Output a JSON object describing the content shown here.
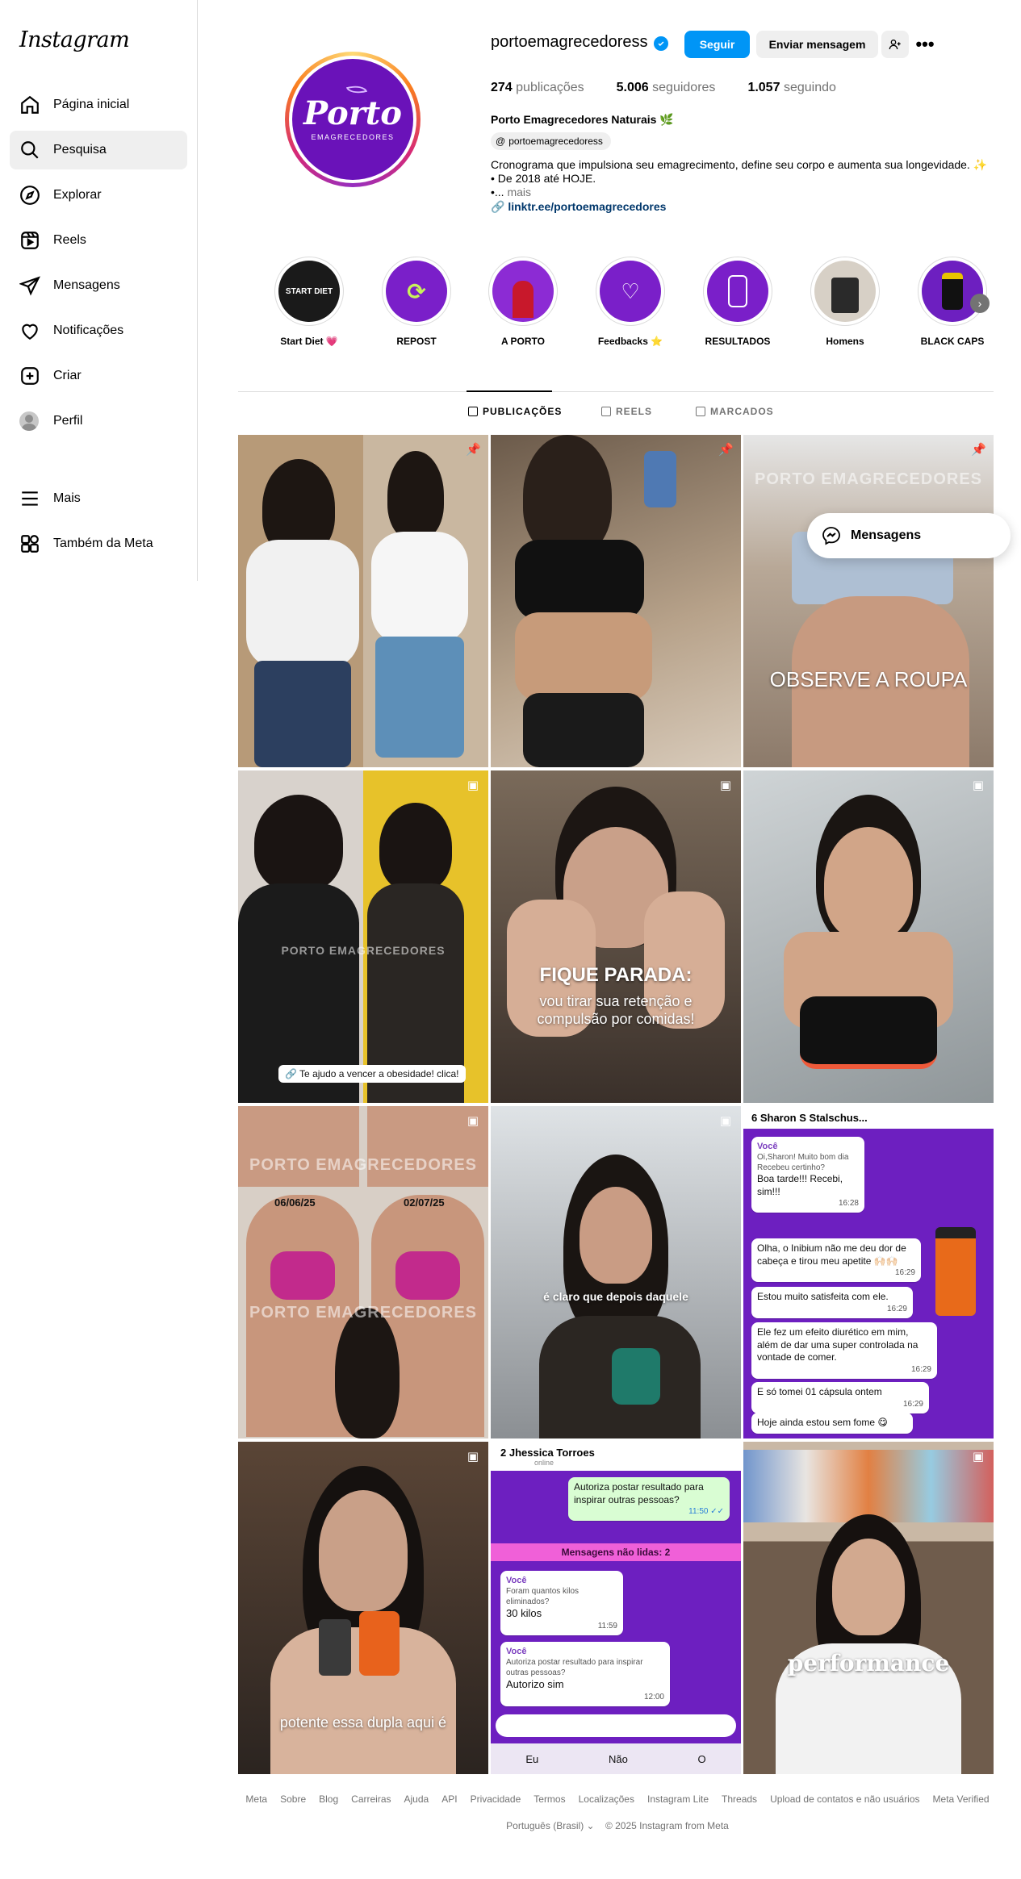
{
  "app": {
    "logo_text": "Instagram"
  },
  "sidebar": {
    "items": [
      {
        "label": "Página inicial",
        "icon": "home-icon"
      },
      {
        "label": "Pesquisa",
        "icon": "search-icon"
      },
      {
        "label": "Explorar",
        "icon": "compass-icon"
      },
      {
        "label": "Reels",
        "icon": "reels-icon"
      },
      {
        "label": "Mensagens",
        "icon": "send-icon"
      },
      {
        "label": "Notificações",
        "icon": "heart-icon"
      },
      {
        "label": "Criar",
        "icon": "plus-square-icon"
      },
      {
        "label": "Perfil",
        "icon": "avatar-icon"
      },
      {
        "label": "Mais",
        "icon": "menu-icon"
      },
      {
        "label": "Também da Meta",
        "icon": "meta-apps-icon"
      }
    ],
    "active_index": 1
  },
  "profile": {
    "username": "portoemagrecedoress",
    "avatar_text_big": "Porto",
    "avatar_text_small": "EMAGRECEDORES",
    "follow_label": "Seguir",
    "message_label": "Enviar mensagem",
    "stats": {
      "posts_value": "274",
      "posts_label": "publicações",
      "followers_value": "5.006",
      "followers_label": "seguidores",
      "following_value": "1.057",
      "following_label": "seguindo"
    },
    "display_name": "Porto Emagrecedores Naturais 🌿",
    "threads_handle": "portoemagrecedoress",
    "bio_line1": "Cronograma que impulsiona seu emagrecimento, define seu corpo e aumenta sua longevidade. ✨",
    "bio_line2": "• De 2018 até HOJE.",
    "bio_line3_prefix": "•...",
    "bio_more": "mais",
    "link": "linktr.ee/portoemagrecedores"
  },
  "highlights": [
    {
      "label": "Start Diet 💗",
      "inner": "START DIET",
      "color": "#1a1a1a"
    },
    {
      "label": "REPOST",
      "inner": "⟳",
      "color": "#7a1fc9"
    },
    {
      "label": "A PORTO",
      "inner": "",
      "color": "#8c2bd4"
    },
    {
      "label": "Feedbacks ⭐",
      "inner": "♡",
      "color": "#7a1fc9"
    },
    {
      "label": "RESULTADOS",
      "inner": "",
      "color": "#7a1fc9"
    },
    {
      "label": "Homens",
      "inner": "",
      "color": "#bdb3a6"
    },
    {
      "label": "BLACK CAPS",
      "inner": "",
      "color": "#6d1fc0"
    }
  ],
  "tabs": [
    {
      "label": "PUBLICAÇÕES"
    },
    {
      "label": "REELS"
    },
    {
      "label": "MARCADOS"
    }
  ],
  "posts": {
    "p1_icon": "pin-icon",
    "p2_icon": "pin-icon",
    "p3_icon": "pin-icon",
    "p3_watermark": "PORTO EMAGRECEDORES",
    "p3_caption": "OBSERVE A ROUPA",
    "p4_watermark": "PORTO EMAGRECEDORES",
    "p4_sticker": "🔗 Te ajudo a vencer a obesidade! clica!",
    "p5_caption_title": "FIQUE PARADA:",
    "p5_caption_sub": "vou tirar sua retenção e compulsão por comidas!",
    "p7_watermark_top": "PORTO EMAGRECEDORES",
    "p7_watermark_bottom": "PORTO EMAGRECEDORES",
    "p7_date_left": "06/06/25",
    "p7_date_right": "02/07/25",
    "p8_caption": "é claro que depois daquele",
    "p9_header": "6   Sharon S Stalschus...",
    "p9_b1_who": "Você",
    "p9_b1_quote": "Oi,Sharon! Muito bom dia Recebeu certinho?",
    "p9_b1_text": "Boa tarde!!! Recebi, sim!!!",
    "p9_b1_time": "16:28",
    "p9_b2_text": "Olha, o Inibium não me deu dor de cabeça e tirou meu apetite 🙌🏻🙌🏻",
    "p9_b2_time": "16:29",
    "p9_b3_text": "Estou muito satisfeita com ele.",
    "p9_b3_time": "16:29",
    "p9_b4_text": "Ele fez um efeito diurético em mim, além de dar uma super controlada na vontade de comer.",
    "p9_b4_time": "16:29",
    "p9_b5_text": "E só tomei 01 cápsula ontem",
    "p9_b5_time": "16:29",
    "p9_b6_text": "Hoje ainda estou sem fome 😋",
    "p10_caption": "potente essa dupla aqui é",
    "p11_header": "2   Jhessica Torroes",
    "p11_status": "online",
    "p11_g1": "Autoriza postar resultado para inspirar outras pessoas?",
    "p11_g1_time": "11:50 ✓✓",
    "p11_unread": "Mensagens não lidas: 2",
    "p11_b1_who": "Você",
    "p11_b1_quote": "Foram quantos kilos eliminados?",
    "p11_b1_text": "30 kilos",
    "p11_b1_time": "11:59",
    "p11_b2_who": "Você",
    "p11_b2_quote": "Autoriza postar resultado para inspirar outras pessoas?",
    "p11_b2_text": "Autorizo sim",
    "p11_b2_time": "12:00",
    "p11_kb1": "Eu",
    "p11_kb2": "Não",
    "p11_kb3": "O",
    "p12_caption": "performance"
  },
  "floating": {
    "messages_label": "Mensagens"
  },
  "footer": {
    "links": [
      "Meta",
      "Sobre",
      "Blog",
      "Carreiras",
      "Ajuda",
      "API",
      "Privacidade",
      "Termos",
      "Localizações",
      "Instagram Lite",
      "Threads",
      "Upload de contatos e não usuários",
      "Meta Verified"
    ],
    "language": "Português (Brasil) ⌄",
    "copyright": "© 2025 Instagram from Meta"
  },
  "colors": {
    "accent": "#0095f6",
    "brand_purple": "#6a12b9",
    "text_secondary": "#737373"
  }
}
